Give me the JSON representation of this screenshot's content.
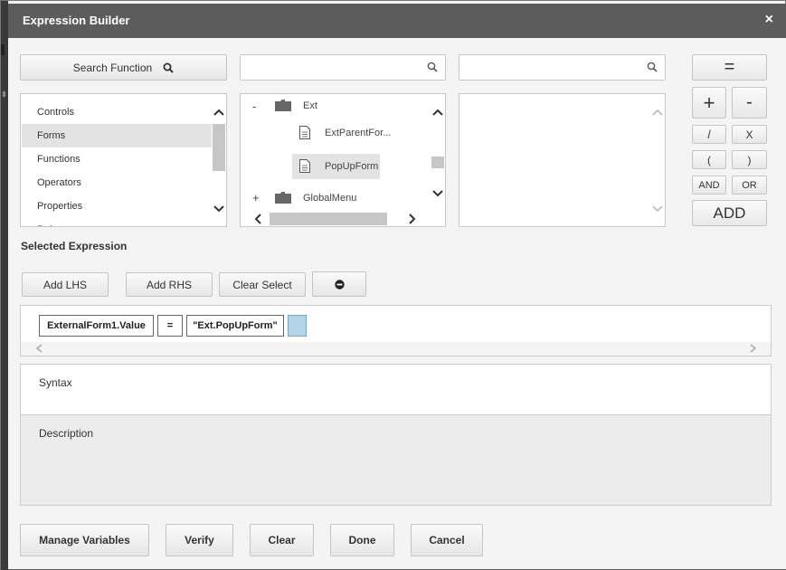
{
  "dialog": {
    "title": "Expression Builder",
    "close_glyph": "×"
  },
  "search_function": {
    "label": "Search Function"
  },
  "search1": {
    "value": "",
    "placeholder": ""
  },
  "search2": {
    "value": "",
    "placeholder": ""
  },
  "categories": {
    "items": [
      {
        "label": "Controls"
      },
      {
        "label": "Forms",
        "selected": true
      },
      {
        "label": "Functions"
      },
      {
        "label": "Operators"
      },
      {
        "label": "Properties"
      },
      {
        "label": "Rules"
      }
    ]
  },
  "tree": {
    "nodes": [
      {
        "toggle": "-",
        "label": "Ext",
        "type": "folder"
      },
      {
        "label": "ExtParentFor...",
        "type": "form"
      },
      {
        "label": "PopUpForm",
        "type": "form",
        "selected": true
      },
      {
        "toggle": "+",
        "label": "GlobalMenu",
        "type": "folder"
      }
    ]
  },
  "operators": {
    "equals": "=",
    "plus": "+",
    "minus": "-",
    "divide": "/",
    "multiply": "X",
    "open_paren": "(",
    "close_paren": ")",
    "and": "AND",
    "or": "OR",
    "add": "ADD"
  },
  "selected_expression": {
    "label": "Selected Expression",
    "add_lhs": "Add LHS",
    "add_rhs": "Add RHS",
    "clear_select": "Clear Select",
    "tokens": [
      "ExternalForm1.Value",
      "=",
      "\"Ext.PopUpForm\""
    ]
  },
  "syntax": {
    "label": "Syntax"
  },
  "description": {
    "label": "Description"
  },
  "footer": {
    "manage_variables": "Manage Variables",
    "verify": "Verify",
    "clear": "Clear",
    "done": "Done",
    "cancel": "Cancel"
  },
  "icons": {
    "search": "search-icon",
    "close": "close-icon",
    "minus_circle": "minus-circle-icon",
    "folder": "folder-icon",
    "document": "document-icon"
  },
  "colors": {
    "titlebar": "#5c5c5c",
    "selected_row": "#e3e3e3",
    "empty_token": "#b3d4e6",
    "description_bg": "#ececec"
  }
}
